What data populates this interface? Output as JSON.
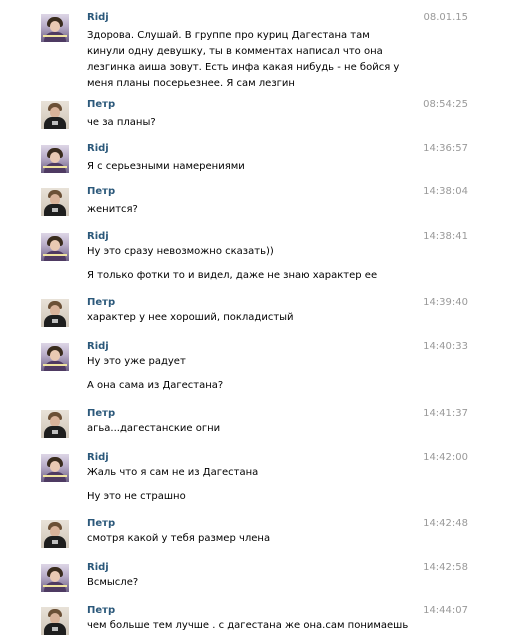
{
  "messages": [
    {
      "author": "Ridj",
      "time": "08.01.15",
      "texts": [
        "Здорова. Слушай. В группе про куриц Дагестана там кинули одну девушку, ты в комментах написал что она лезгинка аиша зовут. Есть инфа какая нибудь - не бойся у меня планы посерьезнее. Я сам лезгин"
      ]
    },
    {
      "author": "Петр",
      "time": "08:54:25",
      "texts": [
        "че за планы?"
      ]
    },
    {
      "author": "Ridj",
      "time": "14:36:57",
      "texts": [
        "Я с серьезными намерениями"
      ]
    },
    {
      "author": "Петр",
      "time": "14:38:04",
      "texts": [
        "женится?"
      ]
    },
    {
      "author": "Ridj",
      "time": "14:38:41",
      "texts": [
        "Ну это сразу невозможно сказать))",
        "Я только фотки то и видел, даже не знаю характер ее"
      ]
    },
    {
      "author": "Петр",
      "time": "14:39:40",
      "texts": [
        "характер у нее хороший, покладистый"
      ]
    },
    {
      "author": "Ridj",
      "time": "14:40:33",
      "texts": [
        "Ну это уже радует",
        "А она сама из Дагестана?"
      ]
    },
    {
      "author": "Петр",
      "time": "14:41:37",
      "texts": [
        "агьа...дагестанские огни"
      ]
    },
    {
      "author": "Ridj",
      "time": "14:42:00",
      "texts": [
        "Жаль что я сам не из Дагестана",
        "Ну это не страшно"
      ]
    },
    {
      "author": "Петр",
      "time": "14:42:48",
      "texts": [
        "смотря какой у тебя размер члена"
      ]
    },
    {
      "author": "Ridj",
      "time": "14:42:58",
      "texts": [
        "Всмысле?"
      ]
    },
    {
      "author": "Петр",
      "time": "14:44:07",
      "texts": [
        "чем больше тем лучше . с дагестана же она.сам понимаешь"
      ]
    }
  ]
}
